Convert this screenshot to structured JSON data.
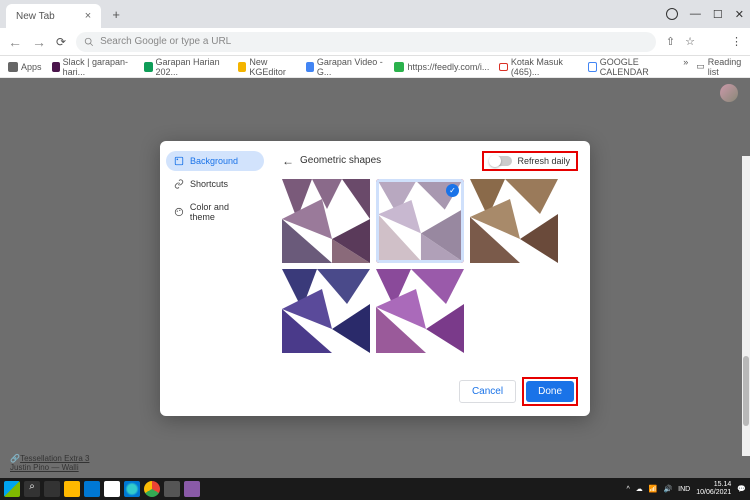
{
  "titlebar": {
    "tab_title": "New Tab",
    "new_tab": "+"
  },
  "omnibox": {
    "placeholder": "Search Google or type a URL"
  },
  "bookmarks": {
    "apps": "Apps",
    "slack": "Slack | garapan-hari...",
    "sheets": "Garapan Harian 202...",
    "kgeditor": "New KGEditor",
    "video": "Garapan Video - G...",
    "feedly": "https://feedly.com/i...",
    "gmail": "Kotak Masuk (465)...",
    "calendar": "GOOGLE CALENDAR",
    "reading": "Reading list"
  },
  "dialog": {
    "sidebar": {
      "background": "Background",
      "shortcuts": "Shortcuts",
      "color": "Color and theme"
    },
    "title": "Geometric shapes",
    "refresh": "Refresh daily",
    "cancel": "Cancel",
    "done": "Done"
  },
  "credit": {
    "title": "Tessellation Extra 3",
    "author": "Justin Pino — Walli"
  },
  "tray": {
    "lang": "IND",
    "time": "15.14",
    "date": "10/06/2021"
  }
}
